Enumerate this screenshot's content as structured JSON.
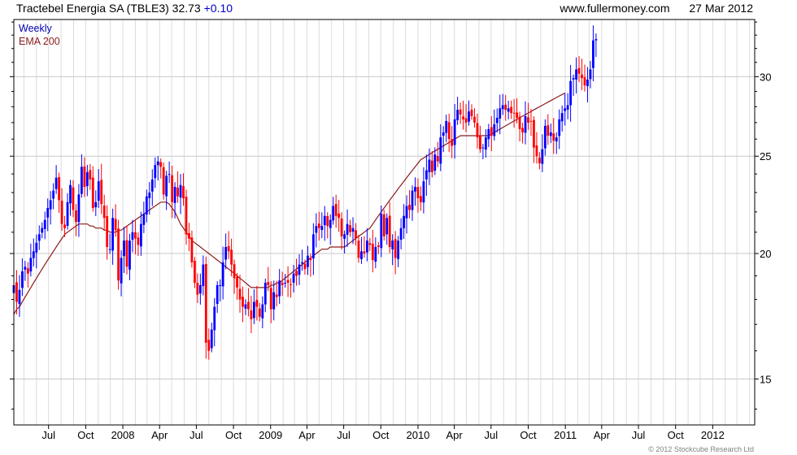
{
  "header": {
    "title": "Tractebel Energia SA (TBLE3) 32.73",
    "change": "+0.10",
    "site": "www.fullermoney.com",
    "date": "27 Mar 2012"
  },
  "legend": {
    "weekly": "Weekly",
    "ema": "EMA 200"
  },
  "footer": {
    "copyright": "© 2012 Stockcube Research Ltd"
  },
  "colors": {
    "up": "#0000ff",
    "down": "#ff0000",
    "ema": "#8b1a1a",
    "grid": "#c8c8c8",
    "axis": "#000000"
  },
  "chart_data": {
    "type": "candlestick",
    "frequency": "weekly",
    "title": "Tractebel Energia SA (TBLE3)",
    "ylim": [
      13.5,
      34.2
    ],
    "yscale": "log",
    "yticks": [
      15,
      20,
      25,
      30
    ],
    "grid": true,
    "x_start": "2007-04-06",
    "x_end": "2012-04-14",
    "xticks": [
      {
        "label": "Jul",
        "date": "2007-07-01"
      },
      {
        "label": "Oct",
        "date": "2007-10-01"
      },
      {
        "label": "2008",
        "date": "2008-01-01"
      },
      {
        "label": "Apr",
        "date": "2008-04-01"
      },
      {
        "label": "Jul",
        "date": "2008-07-01"
      },
      {
        "label": "Oct",
        "date": "2008-10-01"
      },
      {
        "label": "2009",
        "date": "2009-01-01"
      },
      {
        "label": "Apr",
        "date": "2009-04-01"
      },
      {
        "label": "Jul",
        "date": "2009-07-01"
      },
      {
        "label": "Oct",
        "date": "2009-10-01"
      },
      {
        "label": "2010",
        "date": "2010-01-01"
      },
      {
        "label": "Apr",
        "date": "2010-04-01"
      },
      {
        "label": "Jul",
        "date": "2010-07-01"
      },
      {
        "label": "Oct",
        "date": "2010-10-01"
      },
      {
        "label": "2011",
        "date": "2011-01-01"
      },
      {
        "label": "Apr",
        "date": "2011-04-01"
      },
      {
        "label": "Jul",
        "date": "2011-07-01"
      },
      {
        "label": "Oct",
        "date": "2011-10-01"
      },
      {
        "label": "2012",
        "date": "2012-01-01"
      }
    ],
    "ohlc": {
      "start_date": "2007-04-06",
      "interval_days": 7,
      "closes": [
        18.6,
        17.9,
        18.4,
        19.2,
        19.4,
        19.1,
        19.8,
        20.1,
        20.5,
        20.9,
        21.2,
        21.6,
        22.2,
        22.6,
        23.1,
        23.8,
        22.6,
        21.4,
        21.2,
        22.5,
        23.4,
        22.1,
        21.5,
        22.9,
        24.4,
        23.3,
        24.1,
        23.7,
        22.2,
        22.5,
        23.6,
        22.4,
        21.7,
        20.3,
        20.2,
        21.7,
        21.1,
        18.8,
        19.8,
        20.6,
        19.4,
        20.6,
        21.0,
        20.7,
        20.4,
        21.4,
        21.9,
        22.8,
        23.0,
        23.7,
        24.5,
        24.7,
        24.4,
        22.9,
        23.9,
        24.0,
        22.5,
        23.3,
        22.8,
        23.4,
        22.7,
        20.9,
        20.7,
        19.6,
        18.7,
        18.2,
        18.6,
        19.5,
        16.3,
        16.0,
        16.8,
        17.7,
        18.6,
        18.6,
        19.6,
        20.3,
        20.1,
        19.5,
        18.9,
        18.5,
        18.0,
        17.7,
        17.8,
        17.6,
        17.2,
        17.9,
        17.7,
        17.3,
        17.8,
        18.7,
        18.6,
        17.6,
        18.3,
        18.1,
        18.8,
        18.6,
        18.7,
        18.7,
        18.6,
        19.1,
        19.0,
        19.5,
        19.6,
        19.3,
        19.9,
        19.7,
        20.9,
        21.3,
        21.2,
        21.3,
        21.8,
        21.3,
        21.6,
        22.3,
        21.8,
        21.7,
        20.8,
        20.9,
        21.4,
        21.0,
        21.2,
        20.7,
        19.8,
        20.1,
        20.0,
        20.6,
        20.4,
        19.7,
        20.3,
        20.3,
        21.9,
        20.8,
        21.7,
        20.3,
        20.6,
        19.8,
        20.6,
        21.2,
        21.8,
        22.3,
        22.1,
        23.1,
        23.3,
        22.7,
        22.5,
        23.6,
        24.2,
        24.8,
        24.1,
        25.1,
        24.7,
        26.1,
        26.4,
        27.1,
        26.0,
        25.6,
        27.2,
        27.8,
        27.5,
        27.2,
        27.0,
        27.7,
        27.4,
        27.0,
        26.1,
        25.4,
        25.5,
        26.1,
        26.6,
        26.2,
        26.9,
        27.3,
        27.9,
        28.1,
        27.8,
        27.9,
        27.6,
        27.6,
        27.3,
        26.6,
        26.4,
        27.4,
        27.0,
        27.1,
        25.5,
        25.0,
        24.6,
        25.4,
        26.8,
        26.2,
        26.4,
        25.9,
        26.1,
        27.2,
        27.6,
        27.9,
        28.1,
        29.7,
        29.9,
        30.5,
        30.2,
        29.9,
        29.4,
        29.8,
        30.5,
        32.6,
        32.7
      ],
      "ema": [
        17.4,
        17.6,
        17.7,
        17.9,
        18.1,
        18.3,
        18.5,
        18.7,
        18.9,
        19.1,
        19.3,
        19.5,
        19.7,
        19.9,
        20.1,
        20.3,
        20.5,
        20.7,
        20.9,
        21.0,
        21.1,
        21.2,
        21.3,
        21.4,
        21.4,
        21.4,
        21.4,
        21.3,
        21.3,
        21.2,
        21.2,
        21.2,
        21.1,
        21.1,
        21.0,
        21.0,
        21.0,
        21.1,
        21.1,
        21.2,
        21.3,
        21.4,
        21.5,
        21.6,
        21.7,
        21.8,
        21.9,
        22.0,
        22.1,
        22.2,
        22.3,
        22.4,
        22.5,
        22.5,
        22.5,
        22.4,
        22.2,
        22.0,
        21.7,
        21.4,
        21.2,
        21.0,
        20.8,
        20.6,
        20.5,
        20.4,
        20.3,
        20.2,
        20.1,
        20.0,
        19.9,
        19.8,
        19.7,
        19.6,
        19.5,
        19.4,
        19.3,
        19.2,
        19.1,
        19.0,
        18.9,
        18.8,
        18.7,
        18.6,
        18.5,
        18.5,
        18.5,
        18.5,
        18.5,
        18.5,
        18.5,
        18.6,
        18.6,
        18.7,
        18.7,
        18.8,
        18.9,
        19.0,
        19.1,
        19.2,
        19.3,
        19.4,
        19.5,
        19.6,
        19.7,
        19.8,
        19.9,
        20.0,
        20.1,
        20.2,
        20.2,
        20.2,
        20.3,
        20.3,
        20.3,
        20.3,
        20.3,
        20.3,
        20.4,
        20.5,
        20.6,
        20.7,
        20.8,
        20.9,
        21.0,
        21.1,
        21.2,
        21.4,
        21.6,
        21.8,
        22.0,
        22.2,
        22.4,
        22.6,
        22.8,
        23.0,
        23.2,
        23.4,
        23.6,
        23.8,
        24.0,
        24.2,
        24.4,
        24.6,
        24.8,
        24.9,
        25.0,
        25.1,
        25.2,
        25.3,
        25.4,
        25.5,
        25.6,
        25.7,
        25.8,
        25.9,
        26.0,
        26.1,
        26.2,
        26.2,
        26.2,
        26.2,
        26.2,
        26.2,
        26.2,
        26.2,
        26.2,
        26.2,
        26.2,
        26.3,
        26.4,
        26.5,
        26.6,
        26.7,
        26.8,
        26.9,
        27.0,
        27.1,
        27.2,
        27.3,
        27.4,
        27.5,
        27.6,
        27.7,
        27.8,
        27.9,
        28.0,
        28.1,
        28.2,
        28.3,
        28.4,
        28.5,
        28.6,
        28.7,
        28.8,
        28.9
      ]
    }
  }
}
